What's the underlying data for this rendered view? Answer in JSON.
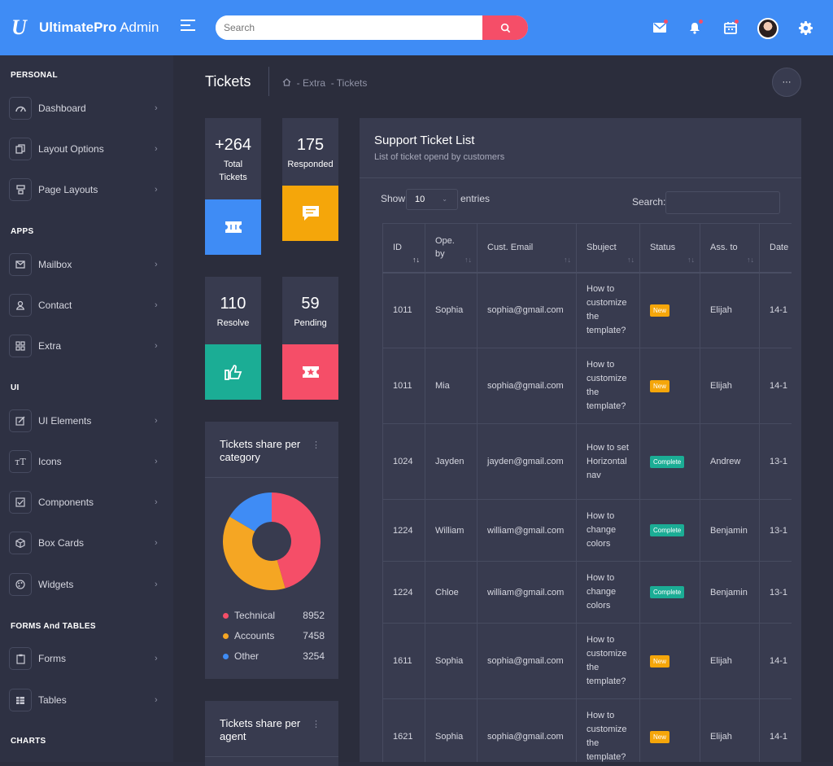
{
  "app": {
    "logo_mark": "U",
    "title_bold": "UltimatePro",
    "title_rest": " Admin"
  },
  "topbar": {
    "search_placeholder": "Search"
  },
  "sidebar": {
    "sections": [
      {
        "label": "PERSONAL"
      },
      {
        "label": "APPS"
      },
      {
        "label": "UI"
      },
      {
        "label": "FORMS And TABLES"
      },
      {
        "label": "CHARTS"
      }
    ],
    "items": [
      {
        "label": "Dashboard",
        "icon": "gauge-icon"
      },
      {
        "label": "Layout Options",
        "icon": "copy-icon"
      },
      {
        "label": "Page Layouts",
        "icon": "layout-icon"
      },
      {
        "label": "Mailbox",
        "icon": "envelope-icon"
      },
      {
        "label": "Contact",
        "icon": "user-icon"
      },
      {
        "label": "Extra",
        "icon": "grid-icon"
      },
      {
        "label": "UI Elements",
        "icon": "edit-icon"
      },
      {
        "label": "Icons",
        "icon": "text-icon"
      },
      {
        "label": "Components",
        "icon": "check-square-icon"
      },
      {
        "label": "Box Cards",
        "icon": "box-icon"
      },
      {
        "label": "Widgets",
        "icon": "palette-icon"
      },
      {
        "label": "Forms",
        "icon": "clipboard-icon"
      },
      {
        "label": "Tables",
        "icon": "table-icon"
      }
    ]
  },
  "page": {
    "title": "Tickets",
    "crumb1": "- Extra",
    "crumb2": "- Tickets",
    "more": "···"
  },
  "stats": [
    {
      "value": "+264",
      "label1": "Total",
      "label2": "Tickets",
      "color": "#3f8cf5"
    },
    {
      "value": "175",
      "label1": "Responded",
      "label2": "",
      "color": "#f5a60a"
    },
    {
      "value": "110",
      "label1": "Resolve",
      "label2": "",
      "color": "#1bad95"
    },
    {
      "value": "59",
      "label1": "Pending",
      "label2": "",
      "color": "#f54e68"
    }
  ],
  "category_card": {
    "title": "Tickets share per category",
    "dots": "⋮",
    "legend": [
      {
        "name": "Technical",
        "value": "8952",
        "color": "#f54e68"
      },
      {
        "name": "Accounts",
        "value": "7458",
        "color": "#f5a623"
      },
      {
        "name": "Other",
        "value": "3254",
        "color": "#3f8cf5"
      }
    ]
  },
  "agent_card": {
    "title": "Tickets share per agent",
    "dots": "⋮"
  },
  "ticket_panel": {
    "title": "Support Ticket List",
    "subtitle": "List of ticket opend by customers",
    "show_label": "Show",
    "show_value": "10",
    "entries_label": "entries",
    "search_label": "Search:",
    "columns": [
      "ID",
      "Ope. by",
      "Cust. Email",
      "Sbuject",
      "Status",
      "Ass. to",
      "Date"
    ],
    "rows": [
      {
        "id": "1011",
        "by": "Sophia",
        "email": "sophia@gmail.com",
        "subject": "How to customize the template?",
        "status": "New",
        "to": "Elijah",
        "date": "14-1"
      },
      {
        "id": "1011",
        "by": "Mia",
        "email": "sophia@gmail.com",
        "subject": "How to customize the template?",
        "status": "New",
        "to": "Elijah",
        "date": "14-1"
      },
      {
        "id": "1024",
        "by": "Jayden",
        "email": "jayden@gmail.com",
        "subject": "How to set Horizontal nav",
        "status": "Complete",
        "to": "Andrew",
        "date": "13-1"
      },
      {
        "id": "1224",
        "by": "William",
        "email": "william@gmail.com",
        "subject": "How to change colors",
        "status": "Complete",
        "to": "Benjamin",
        "date": "13-1"
      },
      {
        "id": "1224",
        "by": "Chloe",
        "email": "william@gmail.com",
        "subject": "How to change colors",
        "status": "Complete",
        "to": "Benjamin",
        "date": "13-1"
      },
      {
        "id": "1611",
        "by": "Sophia",
        "email": "sophia@gmail.com",
        "subject": "How to customize the template?",
        "status": "New",
        "to": "Elijah",
        "date": "14-1"
      },
      {
        "id": "1621",
        "by": "Sophia",
        "email": "sophia@gmail.com",
        "subject": "How to customize the template?",
        "status": "New",
        "to": "Elijah",
        "date": "14-1"
      }
    ]
  }
}
